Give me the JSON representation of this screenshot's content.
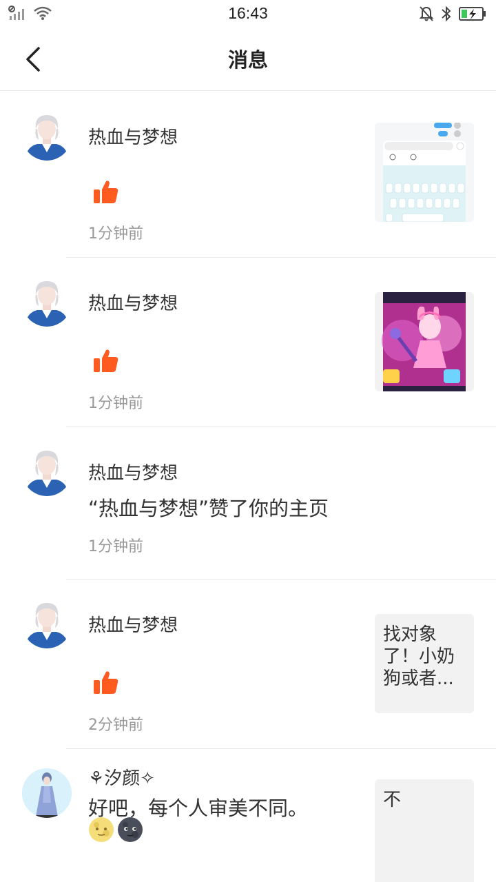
{
  "status": {
    "time": "16:43"
  },
  "header": {
    "title": "消息"
  },
  "messages": [
    {
      "name": "热血与梦想",
      "time": "1分钟前",
      "icon": "thumbs-up-icon",
      "thumb": "keyboard-screenshot"
    },
    {
      "name": "热血与梦想",
      "time": "1分钟前",
      "icon": "thumbs-up-icon",
      "thumb": "pink-game-character"
    },
    {
      "name": "热血与梦想",
      "time": "1分钟前",
      "text": "“热血与梦想”赞了你的主页"
    },
    {
      "name": "热血与梦想",
      "time": "2分钟前",
      "icon": "thumbs-up-icon",
      "thumb_text": "找对象了！小奶狗或者..."
    },
    {
      "name": "⚘汐颜✧",
      "text": "好吧，每个人审美不同。",
      "emojis": [
        "full-moon-face-emoji",
        "new-moon-face-emoji"
      ],
      "thumb_text": "不"
    }
  ],
  "colors": {
    "like": "#ff5a1f",
    "divider": "#e9e9e9",
    "muted": "#999999"
  }
}
